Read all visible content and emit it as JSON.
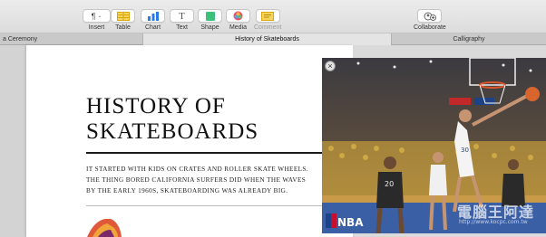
{
  "toolbar": {
    "items": [
      {
        "label": "Insert",
        "icon": "paragraph-icon",
        "disabled": false
      },
      {
        "label": "Table",
        "icon": "table-icon",
        "disabled": false
      },
      {
        "label": "Chart",
        "icon": "chart-icon",
        "disabled": false
      },
      {
        "label": "Text",
        "icon": "text-icon",
        "disabled": false
      },
      {
        "label": "Shape",
        "icon": "shape-icon",
        "disabled": false
      },
      {
        "label": "Media",
        "icon": "media-icon",
        "disabled": false
      },
      {
        "label": "Comment",
        "icon": "comment-icon",
        "disabled": true
      },
      {
        "label": "Collaborate",
        "icon": "collaborate-icon",
        "disabled": false
      }
    ]
  },
  "tabs": [
    {
      "label": "a Ceremony",
      "active": false
    },
    {
      "label": "History of Skateboards",
      "active": true
    },
    {
      "label": "Calligraphy",
      "active": false
    }
  ],
  "document": {
    "title_line1": "History of",
    "title_line2": "Skateboards",
    "body_line1": "It started with kids on crates and roller skate wheels.",
    "body_line2": "The thing bored California surfers did when the waves",
    "body_line3": "by the early 1960s, skateboarding was already big."
  },
  "photo": {
    "close_label": "×",
    "logo_text": "NBA",
    "jersey_numbers": [
      "20",
      "30"
    ],
    "watermark_text": "電腦王阿達",
    "watermark_sub": "http://www.kocpc.com.tw"
  },
  "colors": {
    "table_icon": "#f0c419",
    "chart_icon": "#2c7be5",
    "shape_icon": "#3cc07a",
    "comment_icon": "#f0c419",
    "warriors_blue": "#1d428a",
    "warriors_gold": "#fdb927"
  }
}
